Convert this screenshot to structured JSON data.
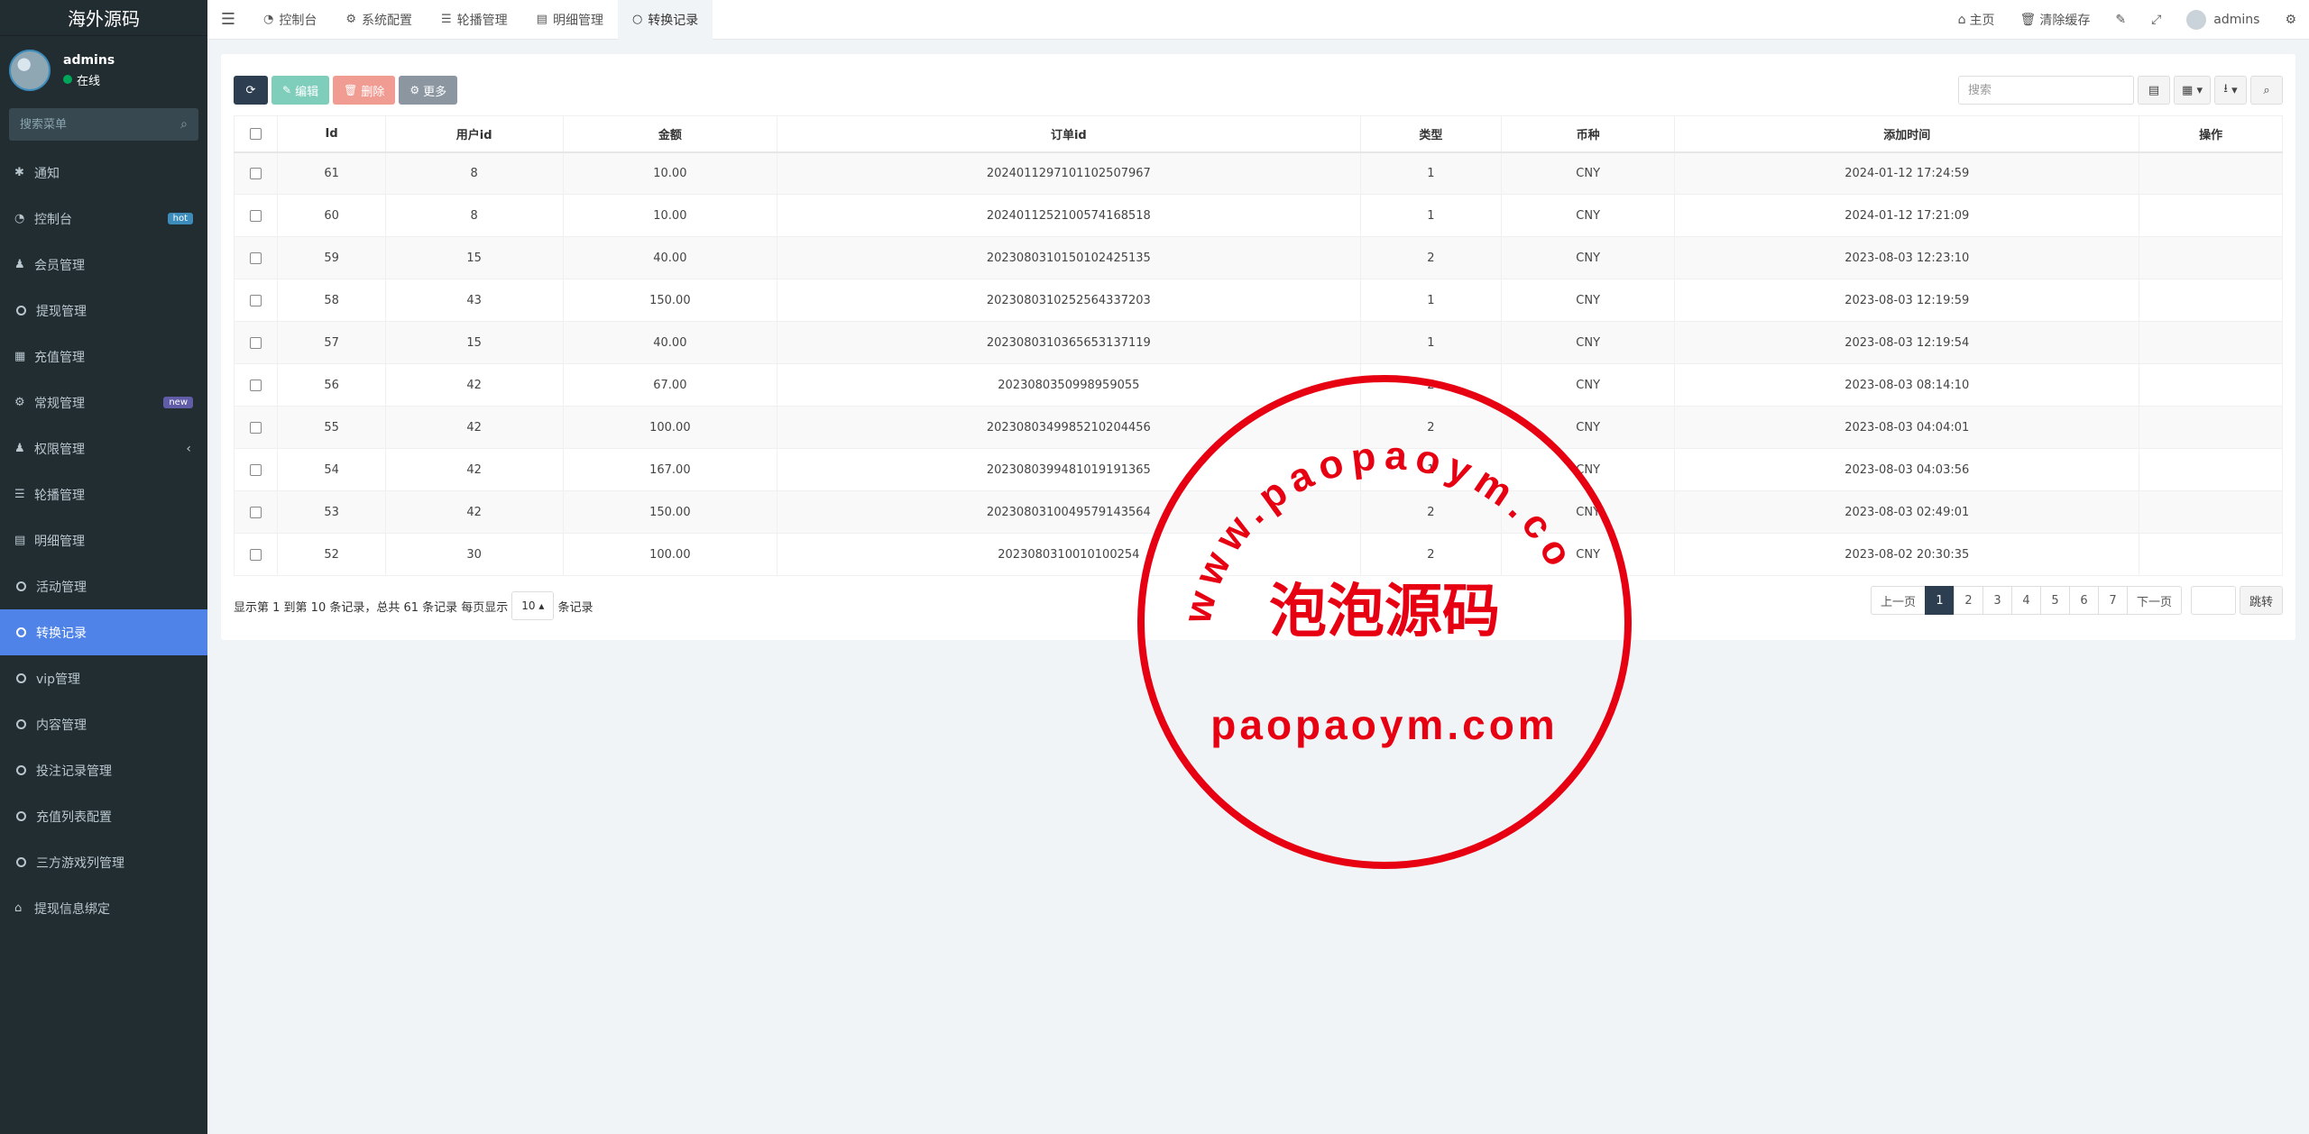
{
  "sidebar": {
    "logo": "海外源码",
    "user": {
      "name": "admins",
      "status": "在线"
    },
    "search_placeholder": "搜索菜单",
    "items": [
      {
        "label": "通知",
        "icon": "gear-icon"
      },
      {
        "label": "控制台",
        "icon": "dashboard-icon",
        "badge": "hot"
      },
      {
        "label": "会员管理",
        "icon": "users-icon"
      },
      {
        "label": "提现管理",
        "icon": "circle-icon"
      },
      {
        "label": "充值管理",
        "icon": "grid-icon"
      },
      {
        "label": "常规管理",
        "icon": "cogs-icon",
        "badge": "new"
      },
      {
        "label": "权限管理",
        "icon": "users-icon",
        "chevron": "‹"
      },
      {
        "label": "轮播管理",
        "icon": "list-icon"
      },
      {
        "label": "明细管理",
        "icon": "calendar-icon"
      },
      {
        "label": "活动管理",
        "icon": "circle-icon"
      },
      {
        "label": "转换记录",
        "icon": "circle-icon",
        "active": true
      },
      {
        "label": "vip管理",
        "icon": "circle-icon"
      },
      {
        "label": "内容管理",
        "icon": "circle-icon"
      },
      {
        "label": "投注记录管理",
        "icon": "circle-icon"
      },
      {
        "label": "充值列表配置",
        "icon": "circle-icon"
      },
      {
        "label": "三方游戏列管理",
        "icon": "circle-icon"
      },
      {
        "label": "提现信息绑定",
        "icon": "bank-icon"
      }
    ]
  },
  "topnav": {
    "tabs": [
      {
        "label": "控制台",
        "icon": "dashboard-icon"
      },
      {
        "label": "系统配置",
        "icon": "gear-icon"
      },
      {
        "label": "轮播管理",
        "icon": "list-icon"
      },
      {
        "label": "明细管理",
        "icon": "calendar-icon"
      },
      {
        "label": "转换记录",
        "icon": "circle-icon",
        "active": true
      }
    ],
    "home": "主页",
    "clear_cache": "清除缓存",
    "username": "admins"
  },
  "toolbar": {
    "edit": "编辑",
    "delete": "删除",
    "more": "更多",
    "search_placeholder": "搜索"
  },
  "table": {
    "columns": [
      "Id",
      "用户id",
      "金额",
      "订单id",
      "类型",
      "币种",
      "添加时间",
      "操作"
    ],
    "rows": [
      [
        "61",
        "8",
        "10.00",
        "202401129710110250796​7",
        "1",
        "CNY",
        "2024-01-12 17:24:59"
      ],
      [
        "60",
        "8",
        "10.00",
        "2024011252100574168518",
        "1",
        "CNY",
        "2024-01-12 17:21:09"
      ],
      [
        "59",
        "15",
        "40.00",
        "2023080310150102425135",
        "2",
        "CNY",
        "2023-08-03 12:23:10"
      ],
      [
        "58",
        "43",
        "150.00",
        "2023080310252564337203",
        "1",
        "CNY",
        "2023-08-03 12:19:59"
      ],
      [
        "57",
        "15",
        "40.00",
        "2023080310365653137119",
        "1",
        "CNY",
        "2023-08-03 12:19:54"
      ],
      [
        "56",
        "42",
        "67.00",
        "2023080350998959055",
        "2",
        "CNY",
        "2023-08-03 08:14:10"
      ],
      [
        "55",
        "42",
        "100.00",
        "2023080349985210204456",
        "2",
        "CNY",
        "2023-08-03 04:04:01"
      ],
      [
        "54",
        "42",
        "167.00",
        "2023080399481019191365",
        "1",
        "CNY",
        "2023-08-03 04:03:56"
      ],
      [
        "53",
        "42",
        "150.00",
        "2023080310049579143564",
        "2",
        "CNY",
        "2023-08-03 02:49:01"
      ],
      [
        "52",
        "30",
        "100.00",
        "2023080310010100254",
        "2",
        "CNY",
        "2023-08-02 20:30:35"
      ]
    ]
  },
  "footer": {
    "info_prefix": "显示第 1 到第 10 条记录，总共 61 条记录 每页显示",
    "page_size": "10",
    "info_suffix": "条记录",
    "prev": "上一页",
    "pages": [
      "1",
      "2",
      "3",
      "4",
      "5",
      "6",
      "7"
    ],
    "next": "下一页",
    "jump": "跳转"
  },
  "watermark": {
    "arc_text": "www.paopaoym.com",
    "center_text": "泡泡源码",
    "bottom_text": "paopaoym.com",
    "color": "#e60012"
  }
}
